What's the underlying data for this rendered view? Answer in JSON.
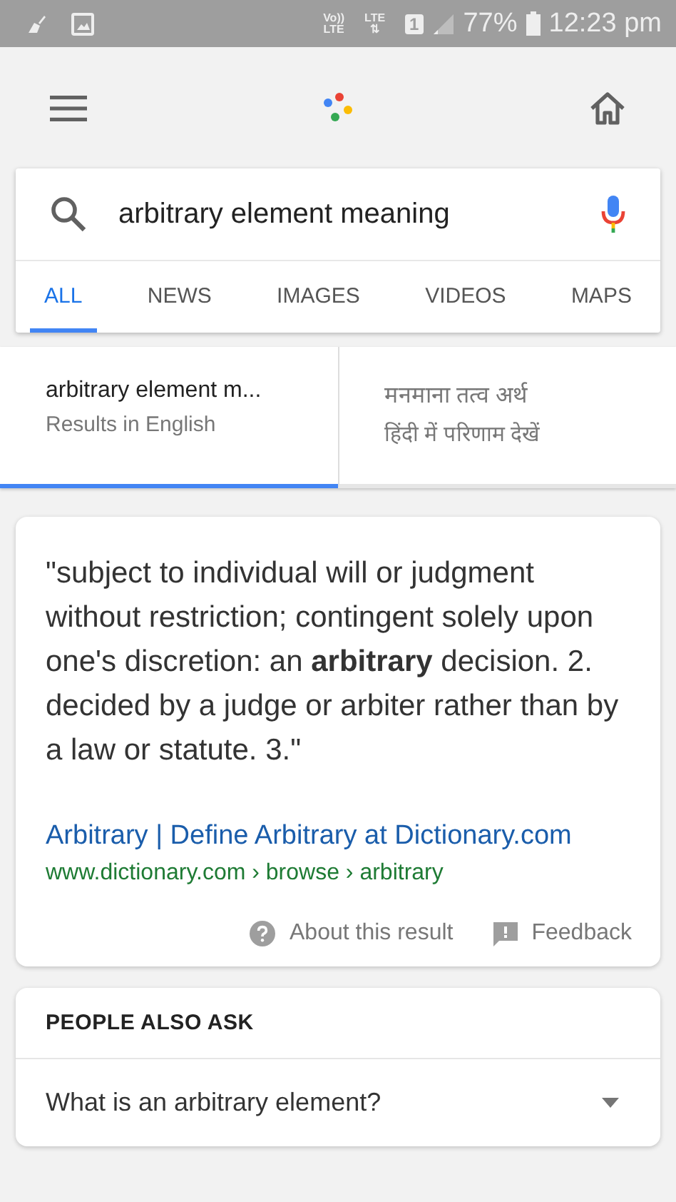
{
  "status_bar": {
    "volte": [
      "Vo))",
      "LTE"
    ],
    "lte": [
      "LTE",
      "⇅"
    ],
    "sim": "1",
    "battery": "77%",
    "time": "12:23 pm"
  },
  "search": {
    "value": "arbitrary element meaning"
  },
  "tabs": [
    {
      "label": "ALL",
      "selected": true
    },
    {
      "label": "NEWS",
      "selected": false
    },
    {
      "label": "IMAGES",
      "selected": false
    },
    {
      "label": "VIDEOS",
      "selected": false
    },
    {
      "label": "MAPS",
      "selected": false
    }
  ],
  "language_tabs": [
    {
      "title": "arbitrary element m...",
      "subtitle": "Results in English",
      "selected": true
    },
    {
      "title": "मनमाना तत्व अर्थ",
      "subtitle": "हिंदी में परिणाम देखें",
      "selected": false
    }
  ],
  "answer": {
    "text": "\"subject to individual will or judgment without restriction; contingent solely upon one's discretion: an **arbitrary** decision. 2. decided by a judge or arbiter rather than by a law or statute. 3.\"",
    "link_title": "Arbitrary | Define Arbitrary at Dictionary.com",
    "url": "www.dictionary.com › browse › arbitrary",
    "about": "About this result",
    "feedback": "Feedback"
  },
  "people_also_ask": {
    "heading": "PEOPLE ALSO ASK",
    "questions": [
      {
        "text": "What is an arbitrary element?",
        "expanded": false
      }
    ]
  }
}
